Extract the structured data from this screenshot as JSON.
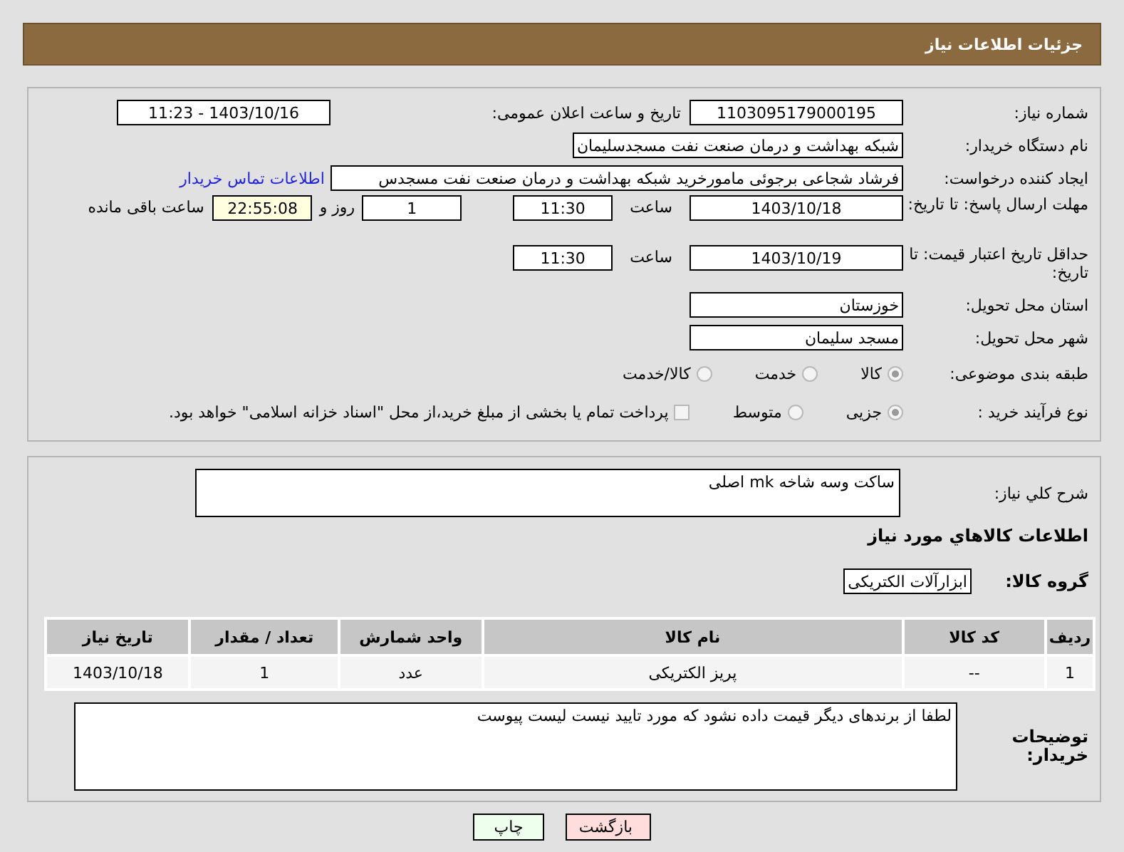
{
  "header": {
    "title": "جزئیات اطلاعات نیاز"
  },
  "details": {
    "need_number": {
      "label": "شماره نیاز:",
      "value": "1103095179000195"
    },
    "announce": {
      "label": "تاریخ و ساعت اعلان عمومی:",
      "value": "1403/10/16 - 11:23"
    },
    "buyer_org": {
      "label": "نام دستگاه خریدار:",
      "value": "شبکه بهداشت و درمان صنعت نفت مسجدسلیمان"
    },
    "requester": {
      "label": "ایجاد کننده درخواست:",
      "value": "فرشاد شجاعی برجوئی مامورخرید شبکه بهداشت و درمان صنعت نفت مسجدس",
      "link": "اطلاعات تماس خریدار"
    },
    "deadline": {
      "label": "مهلت ارسال پاسخ: تا تاریخ:",
      "date": "1403/10/18",
      "time_label": "ساعت",
      "time": "11:30",
      "days": "1",
      "days_label": "روز و",
      "remaining": "22:55:08",
      "remaining_label": "ساعت باقی مانده"
    },
    "validity": {
      "label": "حداقل تاریخ اعتبار قیمت: تا تاریخ:",
      "date": "1403/10/19",
      "time_label": "ساعت",
      "time": "11:30"
    },
    "province": {
      "label": "استان محل تحویل:",
      "value": "خوزستان"
    },
    "city": {
      "label": "شهر محل تحویل:",
      "value": "مسجد سلیمان"
    },
    "category": {
      "label": "طبقه بندی موضوعی:",
      "options": [
        {
          "label": "کالا",
          "selected": true
        },
        {
          "label": "خدمت",
          "selected": false
        },
        {
          "label": "کالا/خدمت",
          "selected": false
        }
      ]
    },
    "process": {
      "label": "نوع فرآیند خرید :",
      "options": [
        {
          "label": "جزیی",
          "selected": true
        },
        {
          "label": "متوسط",
          "selected": false
        }
      ],
      "treasury": {
        "checked": false,
        "label": "پرداخت تمام یا بخشی از مبلغ خرید،از محل \"اسناد خزانه اسلامی\" خواهد بود."
      }
    }
  },
  "goods": {
    "description": {
      "label": "شرح کلي نياز:",
      "value": "ساکت وسه شاخه mk اصلی"
    },
    "heading": "اطلاعات كالاهاي مورد نياز",
    "group": {
      "label": "گروه کالا:",
      "value": "ابزارآلات الکتریکی"
    },
    "table": {
      "columns": [
        "ردیف",
        "کد کالا",
        "نام کالا",
        "واحد شمارش",
        "تعداد / مقدار",
        "تاریخ نیاز"
      ],
      "rows": [
        [
          "1",
          "--",
          "پریز الکتریکی",
          "عدد",
          "1",
          "1403/10/18"
        ]
      ]
    },
    "buyer_notes": {
      "label": "توضیحات خریدار:",
      "value": "لطفا از برندهای دیگر قیمت داده نشود که مورد تایید نیست لیست پیوست"
    }
  },
  "buttons": [
    {
      "label": "بازگشت",
      "kind": "back"
    },
    {
      "label": "چاپ",
      "kind": "print"
    }
  ]
}
